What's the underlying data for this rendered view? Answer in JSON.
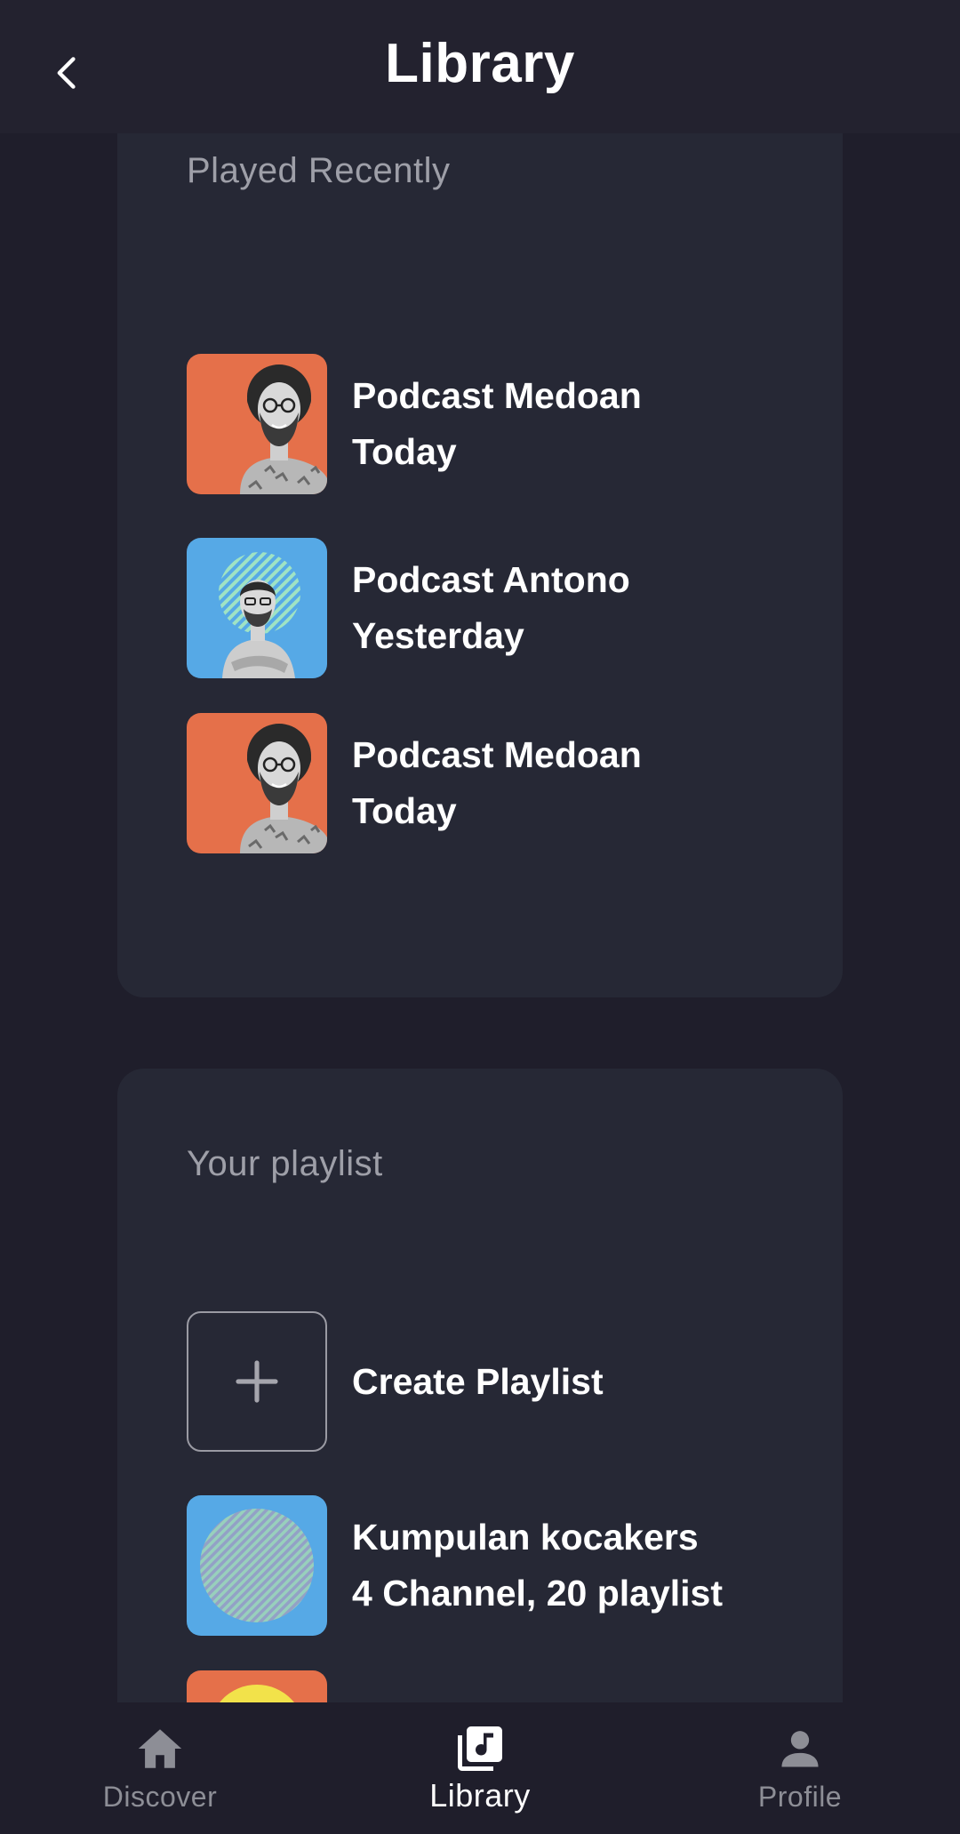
{
  "header": {
    "title": "Library",
    "back_icon": "chevron-left-icon"
  },
  "recent": {
    "title": "Played Recently",
    "items": [
      {
        "name": "Podcast Medoan",
        "time": "Today",
        "thumb_color": "#e5704a"
      },
      {
        "name": "Podcast Antono",
        "time": "Yesterday",
        "thumb_color": "#56a9e6"
      },
      {
        "name": "Podcast Medoan",
        "time": "Today",
        "thumb_color": "#e5704a"
      }
    ]
  },
  "playlist": {
    "title": "Your playlist",
    "create_label": "Create Playlist",
    "items": [
      {
        "name": "Kumpulan kocakers",
        "meta": "4 Channel, 20 playlist",
        "thumb_color": "#56a9e6"
      }
    ]
  },
  "nav": {
    "items": [
      {
        "label": "Discover",
        "icon": "home-icon",
        "active": false
      },
      {
        "label": "Library",
        "icon": "library-music-icon",
        "active": true
      },
      {
        "label": "Profile",
        "icon": "person-icon",
        "active": false
      }
    ]
  },
  "colors": {
    "background": "#1f1e2b",
    "card": "#262835",
    "header": "#23222f",
    "accent_orange": "#e5704a",
    "accent_blue": "#56a9e6",
    "muted_text": "#9e9fa8"
  }
}
